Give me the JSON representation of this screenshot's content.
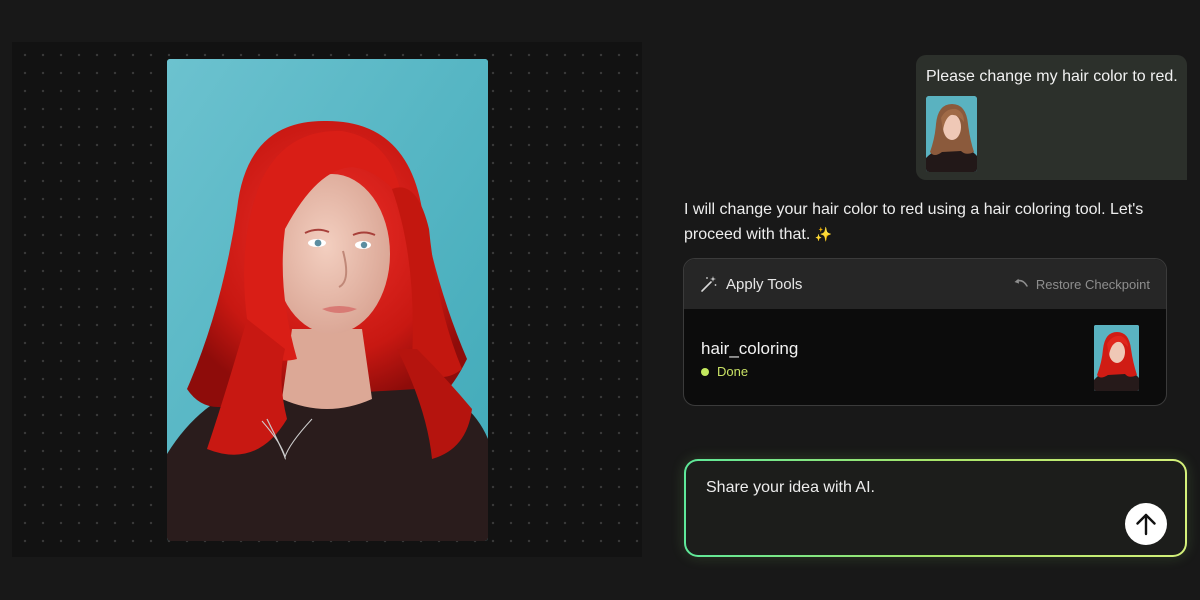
{
  "canvas": {
    "image_icon": "portrait-red-hair"
  },
  "chat": {
    "user_message": {
      "text": "Please change my hair color to red.",
      "attachment_icon": "portrait-brown-hair"
    },
    "ai_message": {
      "text": "I will change your hair color to red using a hair coloring tool. Let's proceed with that.",
      "emoji": "✨"
    },
    "tool_card": {
      "header_icon": "magic-wand-icon",
      "title": "Apply Tools",
      "restore_icon": "undo-arrow-icon",
      "restore_label": "Restore Checkpoint",
      "tool_name": "hair_coloring",
      "status": "Done",
      "status_color": "#c3e85e"
    }
  },
  "composer": {
    "placeholder": "Share your idea with AI.",
    "send_icon": "arrow-up-icon"
  },
  "colors": {
    "background": "#181818",
    "canvas": "#121212",
    "user_bubble": "#2c302b",
    "input_gradient_start": "#5ee89a",
    "input_gradient_end": "#d4f07a"
  }
}
